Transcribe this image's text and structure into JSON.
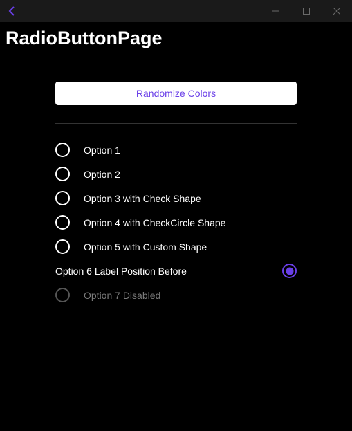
{
  "page": {
    "title": "RadioButtonPage"
  },
  "button": {
    "randomize": "Randomize Colors"
  },
  "options": {
    "o1": "Option 1",
    "o2": "Option 2",
    "o3": "Option 3 with Check Shape",
    "o4": "Option 4 with CheckCircle Shape",
    "o5": "Option 5 with Custom Shape",
    "o6": "Option 6 Label Position Before",
    "o7": "Option 7 Disabled"
  },
  "colors": {
    "accent": "#6a3fe8"
  }
}
